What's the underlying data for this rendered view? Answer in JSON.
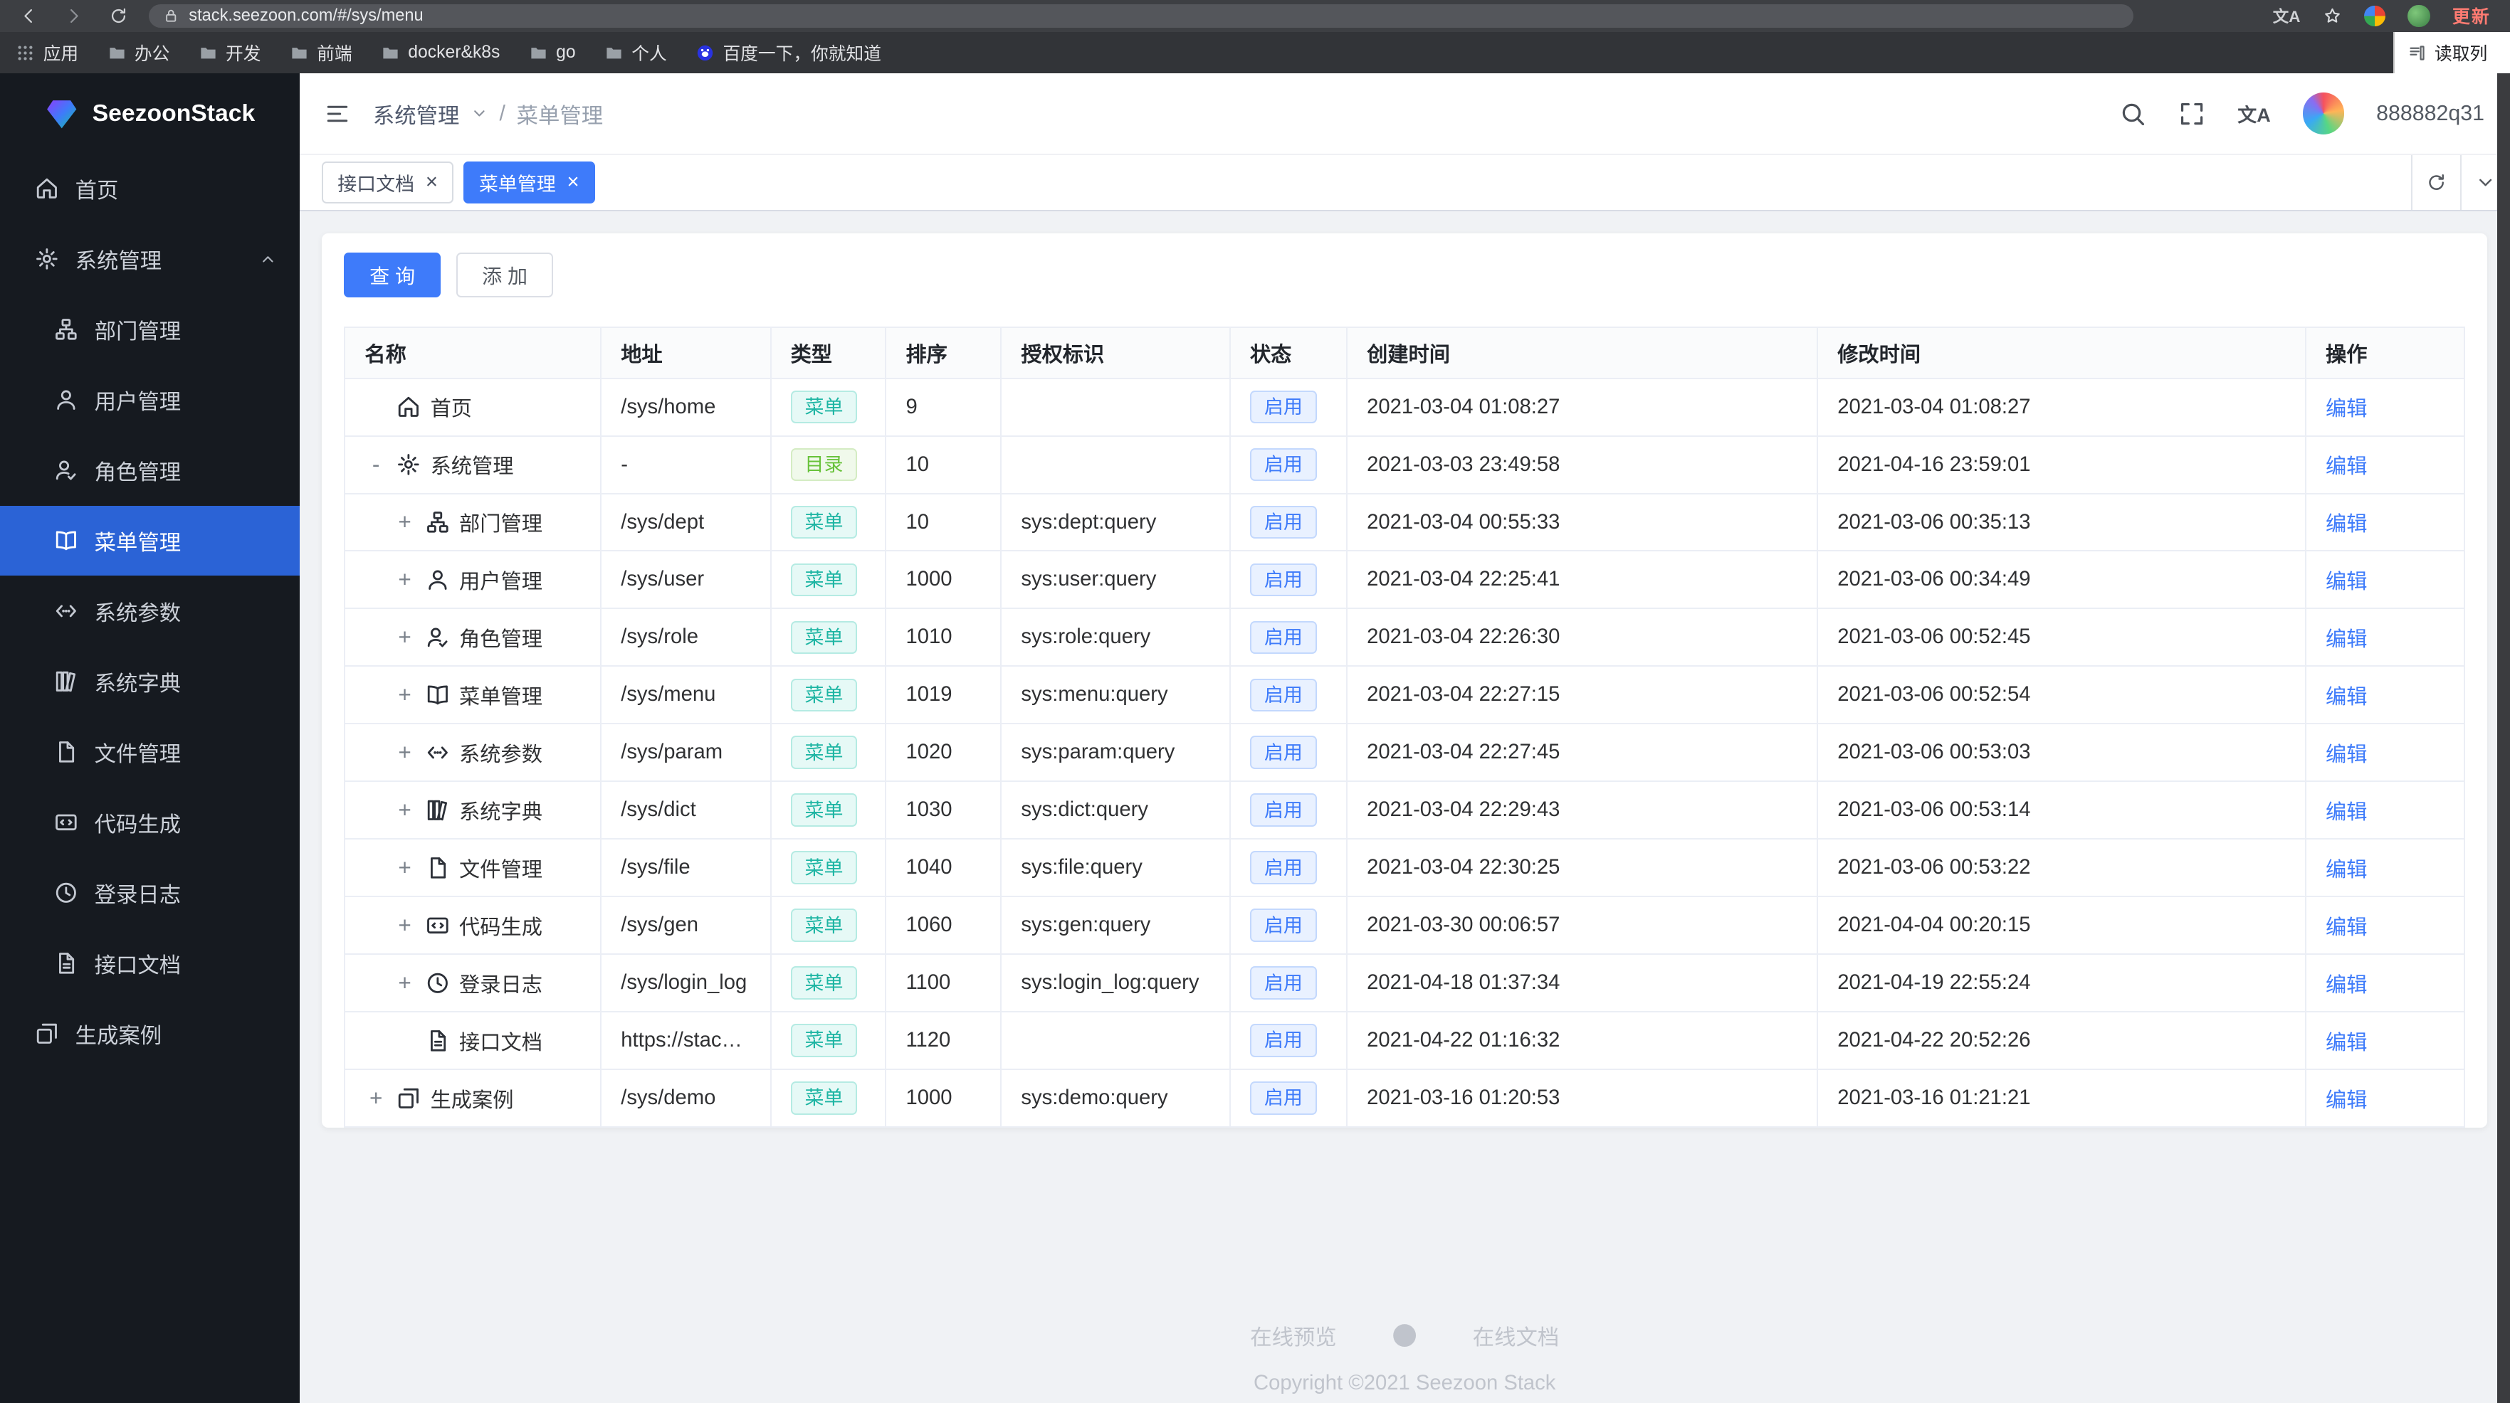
{
  "colors": {
    "primary": "#3e7bfa",
    "sidebar_bg": "#161a20",
    "sidebar_active": "#2b63d6",
    "tag_menu": "#1db5a3",
    "tag_dir": "#67c23a",
    "tag_status": "#3e7bfa",
    "update_red": "#ff7b72",
    "content_bg": "#f0f2f5"
  },
  "browser": {
    "url": "stack.seezoon.com/#/sys/menu",
    "update_label": "更新",
    "reading_list_label": "读取列",
    "bookmarks": [
      {
        "id": "apps",
        "icon": "apps",
        "label": "应用"
      },
      {
        "id": "office",
        "icon": "folder",
        "label": "办公"
      },
      {
        "id": "dev",
        "icon": "folder",
        "label": "开发"
      },
      {
        "id": "frontend",
        "icon": "folder",
        "label": "前端"
      },
      {
        "id": "docker-k8s",
        "icon": "folder",
        "label": "docker&k8s"
      },
      {
        "id": "go",
        "icon": "folder",
        "label": "go"
      },
      {
        "id": "personal",
        "icon": "folder",
        "label": "个人"
      },
      {
        "id": "baidu",
        "icon": "baidu",
        "label": "百度一下，你就知道"
      }
    ]
  },
  "sidebar": {
    "brand": "SeezoonStack",
    "items": [
      {
        "id": "home",
        "icon": "home",
        "label": "首页",
        "level": 0,
        "active": false,
        "expandable": false
      },
      {
        "id": "system-manage",
        "icon": "gear",
        "label": "系统管理",
        "level": 0,
        "active": false,
        "expandable": true
      },
      {
        "id": "dept-manage",
        "icon": "dept",
        "label": "部门管理",
        "level": 1,
        "active": false,
        "expandable": false
      },
      {
        "id": "user-manage",
        "icon": "user",
        "label": "用户管理",
        "level": 1,
        "active": false,
        "expandable": false
      },
      {
        "id": "role-manage",
        "icon": "role",
        "label": "角色管理",
        "level": 1,
        "active": false,
        "expandable": false
      },
      {
        "id": "menu-manage",
        "icon": "book",
        "label": "菜单管理",
        "level": 1,
        "active": true,
        "expandable": false
      },
      {
        "id": "sys-param",
        "icon": "param",
        "label": "系统参数",
        "level": 1,
        "active": false,
        "expandable": false
      },
      {
        "id": "sys-dict",
        "icon": "dict",
        "label": "系统字典",
        "level": 1,
        "active": false,
        "expandable": false
      },
      {
        "id": "file-manage",
        "icon": "file",
        "label": "文件管理",
        "level": 1,
        "active": false,
        "expandable": false
      },
      {
        "id": "code-gen",
        "icon": "gen",
        "label": "代码生成",
        "level": 1,
        "active": false,
        "expandable": false
      },
      {
        "id": "login-log",
        "icon": "clock",
        "label": "登录日志",
        "level": 1,
        "active": false,
        "expandable": false
      },
      {
        "id": "api-doc",
        "icon": "doc",
        "label": "接口文档",
        "level": 1,
        "active": false,
        "expandable": false
      },
      {
        "id": "demo-case",
        "icon": "demo",
        "label": "生成案例",
        "level": 0,
        "active": false,
        "expandable": false
      }
    ]
  },
  "header": {
    "breadcrumb_section": "系统管理",
    "breadcrumb_sep": "/",
    "breadcrumb_current": "菜单管理",
    "username": "888882q31",
    "translate_label": "文A"
  },
  "tabs": [
    {
      "id": "api-doc",
      "label": "接口文档",
      "close": "×",
      "active": false
    },
    {
      "id": "menu-manage",
      "label": "菜单管理",
      "close": "×",
      "active": true
    }
  ],
  "toolbar": {
    "query_label": "查 询",
    "add_label": "添 加"
  },
  "table": {
    "columns": [
      "名称",
      "地址",
      "类型",
      "排序",
      "授权标识",
      "状态",
      "创建时间",
      "修改时间",
      "操作"
    ],
    "action_label": "编辑",
    "type_dir": "目录",
    "rows": [
      {
        "toggle": "",
        "level": 0,
        "icon": "home",
        "name": "首页",
        "url": "/sys/home",
        "type": "菜单",
        "sort": "9",
        "perm": "",
        "status": "启用",
        "created": "2021-03-04 01:08:27",
        "updated": "2021-03-04 01:08:27"
      },
      {
        "toggle": "-",
        "level": 0,
        "icon": "gear",
        "name": "系统管理",
        "url": "-",
        "type": "目录",
        "sort": "10",
        "perm": "",
        "status": "启用",
        "created": "2021-03-03 23:49:58",
        "updated": "2021-04-16 23:59:01"
      },
      {
        "toggle": "+",
        "level": 1,
        "icon": "dept",
        "name": "部门管理",
        "url": "/sys/dept",
        "type": "菜单",
        "sort": "10",
        "perm": "sys:dept:query",
        "status": "启用",
        "created": "2021-03-04 00:55:33",
        "updated": "2021-03-06 00:35:13"
      },
      {
        "toggle": "+",
        "level": 1,
        "icon": "user",
        "name": "用户管理",
        "url": "/sys/user",
        "type": "菜单",
        "sort": "1000",
        "perm": "sys:user:query",
        "status": "启用",
        "created": "2021-03-04 22:25:41",
        "updated": "2021-03-06 00:34:49"
      },
      {
        "toggle": "+",
        "level": 1,
        "icon": "role",
        "name": "角色管理",
        "url": "/sys/role",
        "type": "菜单",
        "sort": "1010",
        "perm": "sys:role:query",
        "status": "启用",
        "created": "2021-03-04 22:26:30",
        "updated": "2021-03-06 00:52:45"
      },
      {
        "toggle": "+",
        "level": 1,
        "icon": "book",
        "name": "菜单管理",
        "url": "/sys/menu",
        "type": "菜单",
        "sort": "1019",
        "perm": "sys:menu:query",
        "status": "启用",
        "created": "2021-03-04 22:27:15",
        "updated": "2021-03-06 00:52:54"
      },
      {
        "toggle": "+",
        "level": 1,
        "icon": "param",
        "name": "系统参数",
        "url": "/sys/param",
        "type": "菜单",
        "sort": "1020",
        "perm": "sys:param:query",
        "status": "启用",
        "created": "2021-03-04 22:27:45",
        "updated": "2021-03-06 00:53:03"
      },
      {
        "toggle": "+",
        "level": 1,
        "icon": "dict",
        "name": "系统字典",
        "url": "/sys/dict",
        "type": "菜单",
        "sort": "1030",
        "perm": "sys:dict:query",
        "status": "启用",
        "created": "2021-03-04 22:29:43",
        "updated": "2021-03-06 00:53:14"
      },
      {
        "toggle": "+",
        "level": 1,
        "icon": "file",
        "name": "文件管理",
        "url": "/sys/file",
        "type": "菜单",
        "sort": "1040",
        "perm": "sys:file:query",
        "status": "启用",
        "created": "2021-03-04 22:30:25",
        "updated": "2021-03-06 00:53:22"
      },
      {
        "toggle": "+",
        "level": 1,
        "icon": "gen",
        "name": "代码生成",
        "url": "/sys/gen",
        "type": "菜单",
        "sort": "1060",
        "perm": "sys:gen:query",
        "status": "启用",
        "created": "2021-03-30 00:06:57",
        "updated": "2021-04-04 00:20:15"
      },
      {
        "toggle": "+",
        "level": 1,
        "icon": "clock",
        "name": "登录日志",
        "url": "/sys/login_log",
        "type": "菜单",
        "sort": "1100",
        "perm": "sys:login_log:query",
        "status": "启用",
        "created": "2021-04-18 01:37:34",
        "updated": "2021-04-19 22:55:24"
      },
      {
        "toggle": "",
        "level": 1,
        "icon": "doc",
        "name": "接口文档",
        "url": "https://stack....",
        "type": "菜单",
        "sort": "1120",
        "perm": "",
        "status": "启用",
        "created": "2021-04-22 01:16:32",
        "updated": "2021-04-22 20:52:26"
      },
      {
        "toggle": "+",
        "level": 0,
        "icon": "demo",
        "name": "生成案例",
        "url": "/sys/demo",
        "type": "菜单",
        "sort": "1000",
        "perm": "sys:demo:query",
        "status": "启用",
        "created": "2021-03-16 01:20:53",
        "updated": "2021-03-16 01:21:21"
      }
    ]
  },
  "footer": {
    "preview": "在线预览",
    "docs": "在线文档",
    "copyright": "Copyright ©2021 Seezoon Stack"
  }
}
